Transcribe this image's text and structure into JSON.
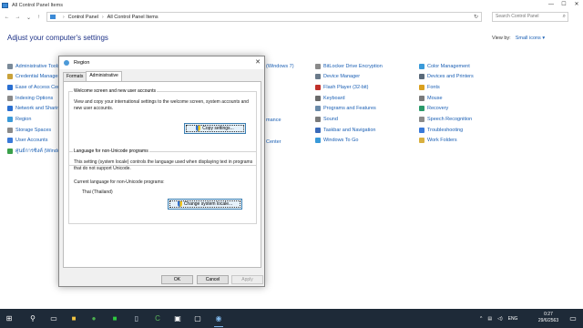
{
  "window": {
    "title": "All Control Panel Items",
    "controls": [
      "—",
      "☐",
      "✕"
    ]
  },
  "address": {
    "crumbs": [
      "Control Panel",
      "All Control Panel Items"
    ],
    "search_placeholder": "Search Control Panel"
  },
  "heading": "Adjust your computer's settings",
  "view_by": {
    "label": "View by:",
    "value": "Small icons ▾"
  },
  "items_col1": [
    {
      "label": "Administrative Tools",
      "color": "#7a8a99"
    },
    {
      "label": "Credential Manager",
      "color": "#c9a23a"
    },
    {
      "label": "Ease of Access Center",
      "color": "#2a6fd1"
    },
    {
      "label": "Indexing Options",
      "color": "#8a8a8a"
    },
    {
      "label": "Network and Sharing Center",
      "color": "#2a6fd1"
    },
    {
      "label": "Region",
      "color": "#3a9ad9"
    },
    {
      "label": "Storage Spaces",
      "color": "#8a8a8a"
    },
    {
      "label": "User Accounts",
      "color": "#3a7ad9"
    },
    {
      "label": "ศูนย์การซิงค์ (Windows 7)",
      "color": "#3aa04a"
    }
  ],
  "items_col2_partial": [
    {
      "label": "(Windows 7)"
    },
    {
      "label": "mance"
    },
    {
      "label": "Center"
    }
  ],
  "items_col3": [
    {
      "label": "BitLocker Drive Encryption",
      "color": "#8a8a8a"
    },
    {
      "label": "Device Manager",
      "color": "#6a7a8a"
    },
    {
      "label": "Flash Player (32-bit)",
      "color": "#c0302a"
    },
    {
      "label": "Keyboard",
      "color": "#6a6a6a"
    },
    {
      "label": "Programs and Features",
      "color": "#6a8aa9"
    },
    {
      "label": "Sound",
      "color": "#7a7a7a"
    },
    {
      "label": "Taskbar and Navigation",
      "color": "#3a6ab9"
    },
    {
      "label": "Windows To Go",
      "color": "#3a9ad9"
    }
  ],
  "items_col4": [
    {
      "label": "Color Management",
      "color": "#3a9ad9"
    },
    {
      "label": "Devices and Printers",
      "color": "#5a6a7a"
    },
    {
      "label": "Fonts",
      "color": "#d9a020"
    },
    {
      "label": "Mouse",
      "color": "#7a7a7a"
    },
    {
      "label": "Recovery",
      "color": "#2a9a6a"
    },
    {
      "label": "Speech Recognition",
      "color": "#8a8a8a"
    },
    {
      "label": "Troubleshooting",
      "color": "#3a7ad9"
    },
    {
      "label": "Work Folders",
      "color": "#d9b040"
    }
  ],
  "dialog": {
    "title": "Region",
    "close": "✕",
    "tabs": [
      "Formats",
      "Administrative"
    ],
    "welcome": {
      "label": "Welcome screen and new user accounts",
      "text": "View and copy your international settings to the welcome screen, system accounts and new user accounts.",
      "button": "Copy settings..."
    },
    "unicode": {
      "label": "Language for non-Unicode programs",
      "text": "This setting (system locale) controls the language used when displaying text in programs that do not support Unicode.",
      "current_label": "Current language for non-Unicode programs:",
      "current_value": "Thai (Thailand)",
      "button": "Change system locale..."
    },
    "buttons": {
      "ok": "OK",
      "cancel": "Cancel",
      "apply": "Apply"
    }
  },
  "taskbar": {
    "icons": [
      "start-icon",
      "search-icon",
      "task-view-icon",
      "file-explorer-icon",
      "chrome-icon",
      "line-icon",
      "notepad-icon",
      "camtasia-icon",
      "media-icon",
      "settings-icon",
      "region-icon"
    ],
    "lang": "ENG",
    "time": "0:27",
    "date": "29/6/2563"
  }
}
